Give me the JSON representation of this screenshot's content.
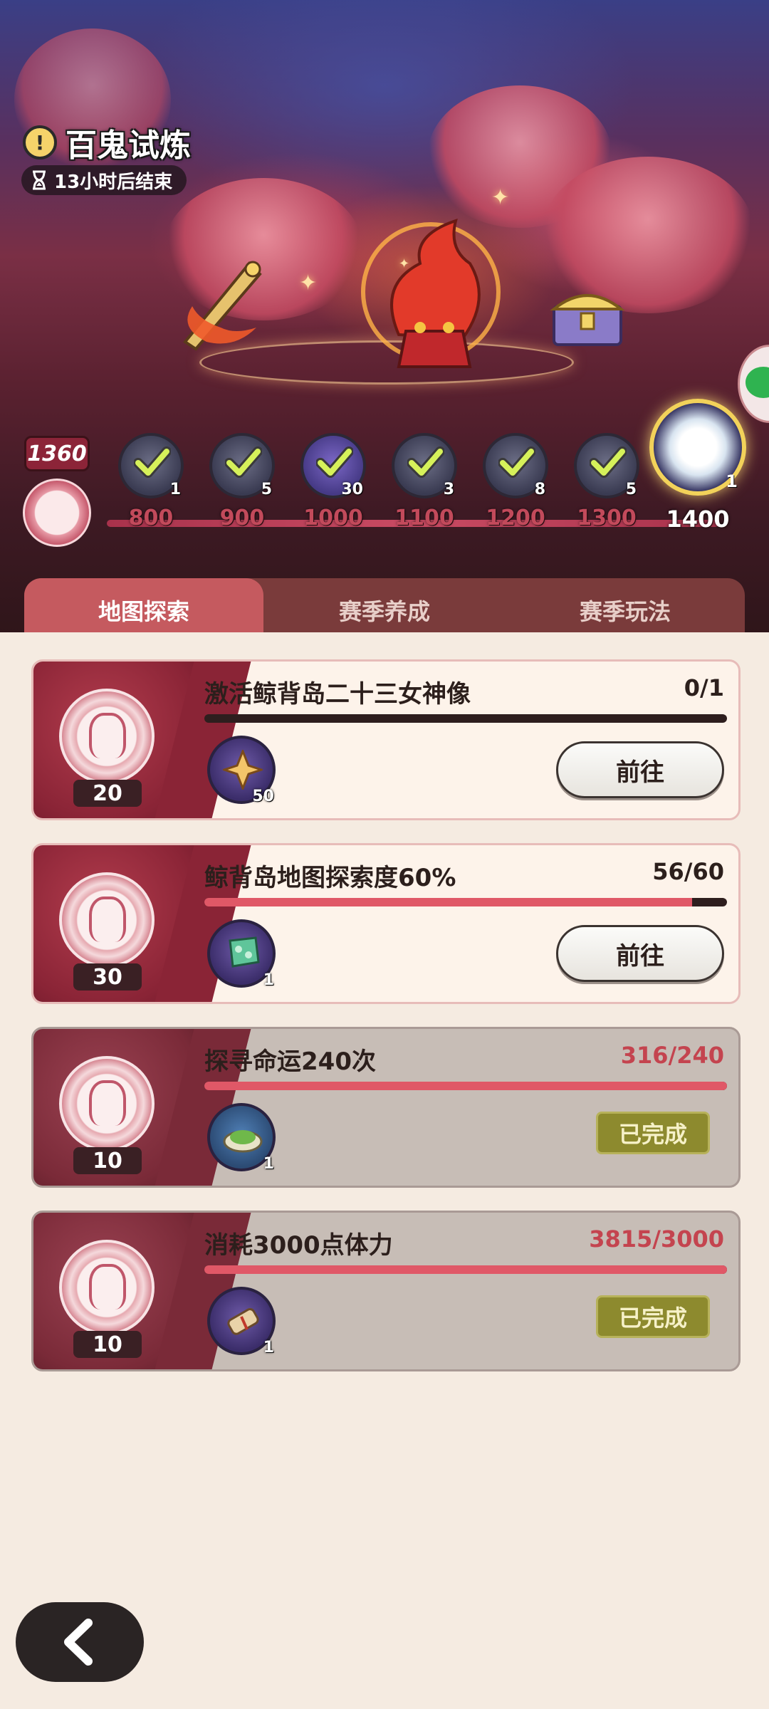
{
  "event": {
    "title": "百鬼试炼",
    "info_icon": "exclamation-icon",
    "timer_text": "13小时后结束",
    "timer_icon": "hourglass-icon"
  },
  "milestones": {
    "current_score": "1360",
    "nodes": [
      {
        "label": "800",
        "qty": "1",
        "claimed": true
      },
      {
        "label": "900",
        "qty": "5",
        "claimed": true
      },
      {
        "label": "1000",
        "qty": "30",
        "claimed": true
      },
      {
        "label": "1100",
        "qty": "3",
        "claimed": true
      },
      {
        "label": "1200",
        "qty": "8",
        "claimed": true
      },
      {
        "label": "1300",
        "qty": "5",
        "claimed": true
      }
    ],
    "final": {
      "label": "1400",
      "qty": "1"
    }
  },
  "tabs": [
    {
      "label": "地图探索",
      "active": true
    },
    {
      "label": "赛季养成",
      "active": false
    },
    {
      "label": "赛季玩法",
      "active": false
    }
  ],
  "tasks": [
    {
      "title": "激活鲸背岛二十三女神像",
      "progress": "0/1",
      "fraction": 0,
      "points": "20",
      "reward_qty": "50",
      "reward_icon": "star-crystal-icon",
      "action": "前往",
      "done": false
    },
    {
      "title": "鲸背岛地图探索度60%",
      "progress": "56/60",
      "fraction": 0.933,
      "points": "30",
      "reward_qty": "1",
      "reward_icon": "jade-bouquet-icon",
      "action": "前往",
      "done": false
    },
    {
      "title": "探寻命运240次",
      "progress": "316/240",
      "fraction": 1,
      "points": "10",
      "reward_qty": "1",
      "reward_icon": "herb-dish-icon",
      "action": "已完成",
      "done": true
    },
    {
      "title": "消耗3000点体力",
      "progress": "3815/3000",
      "fraction": 1,
      "points": "10",
      "reward_qty": "1",
      "reward_icon": "scroll-icon",
      "action": "已完成",
      "done": true
    }
  ],
  "colors": {
    "accent": "#c55a5f",
    "progress": "#e05867",
    "done_badge": "#8d8a2e"
  }
}
